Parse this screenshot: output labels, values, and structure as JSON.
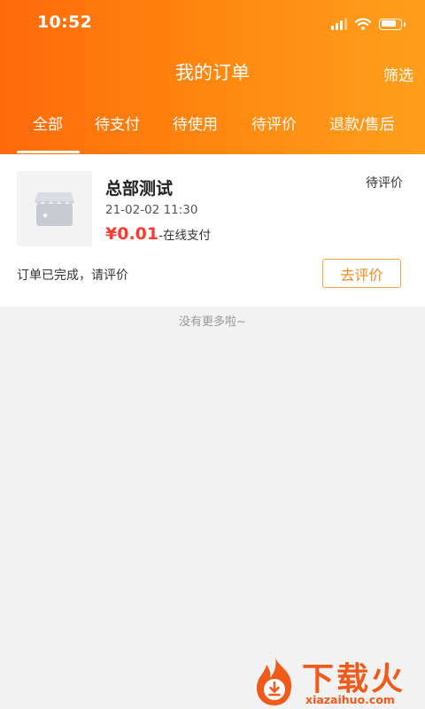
{
  "status_bar": {
    "time": "10:52",
    "battery_level": 0.8
  },
  "header": {
    "title": "我的订单",
    "filter_label": "筛选"
  },
  "tabs": [
    {
      "label": "全部",
      "active": true
    },
    {
      "label": "待支付",
      "active": false
    },
    {
      "label": "待使用",
      "active": false
    },
    {
      "label": "待评价",
      "active": false
    },
    {
      "label": "退款/售后",
      "active": false
    }
  ],
  "order": {
    "store_name": "总部测试",
    "status": "待评价",
    "time": "21-02-02 11:30",
    "price": "¥0.01",
    "pay_method": "-在线支付",
    "note": "订单已完成，请评价",
    "action_label": "去评价",
    "thumb_icon": "store-icon"
  },
  "list_end_text": "没有更多啦~",
  "watermark": {
    "text": "下载火",
    "url": "xiazaihuo.com"
  },
  "colors": {
    "accent": "#ff7a10",
    "price": "#ff3b30",
    "action": "#f08a1c"
  }
}
